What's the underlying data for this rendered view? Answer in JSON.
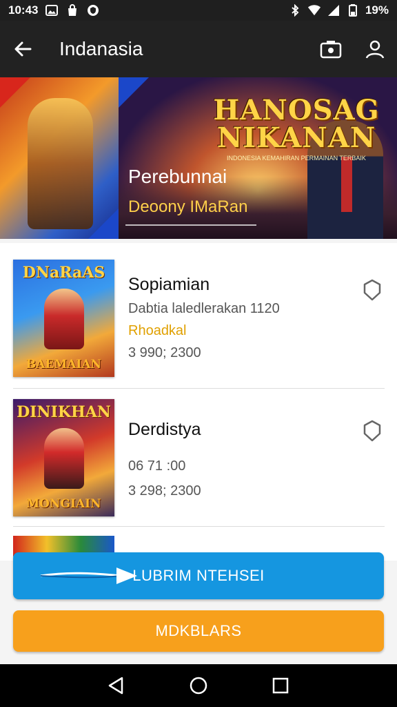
{
  "status_bar": {
    "time": "10:43",
    "battery": "19%",
    "icons": [
      "gallery-icon",
      "shopping-bag-icon",
      "shield-status-icon",
      "bluetooth-icon",
      "wifi-icon",
      "signal-icon",
      "battery-icon"
    ]
  },
  "app_bar": {
    "title": "Indanasia",
    "back_icon": "arrow-left-icon",
    "actions": [
      "camera-icon",
      "profile-icon"
    ]
  },
  "banner": {
    "title_line1": "HANOSAG",
    "title_line2": "NIKANAN",
    "tagline": "INDONESIA KEMAHIRAN PERMAINAN TERBAIK",
    "heading": "Perebunnai",
    "subheading": "Deoony IMaRan"
  },
  "list": [
    {
      "thumb_top": "DNaRaAS",
      "thumb_bottom": "BAEMAIAN",
      "name": "Sopiamian",
      "line1": "Dabtia laledlerakan 1120",
      "line2": "Rhoadkal",
      "line3": "3 990; 2300",
      "action_icon": "shield-outline-icon"
    },
    {
      "thumb_top": "DINIKHAN",
      "thumb_bottom": "MONGIAIN",
      "name": "Derdistya",
      "line1": "06 71 :00",
      "line3": "3 298; 2300",
      "action_icon": "shield-outline-icon"
    }
  ],
  "buttons": {
    "primary": "LUBRIM NTEHSEI",
    "secondary": "MDKBLARS"
  },
  "colors": {
    "primary_button": "#1596e0",
    "secondary_button": "#f7a01c",
    "app_bar": "#222222",
    "highlight_text": "#e0a000"
  },
  "nav_bar": [
    "back-triangle-icon",
    "home-circle-icon",
    "recents-square-icon"
  ]
}
